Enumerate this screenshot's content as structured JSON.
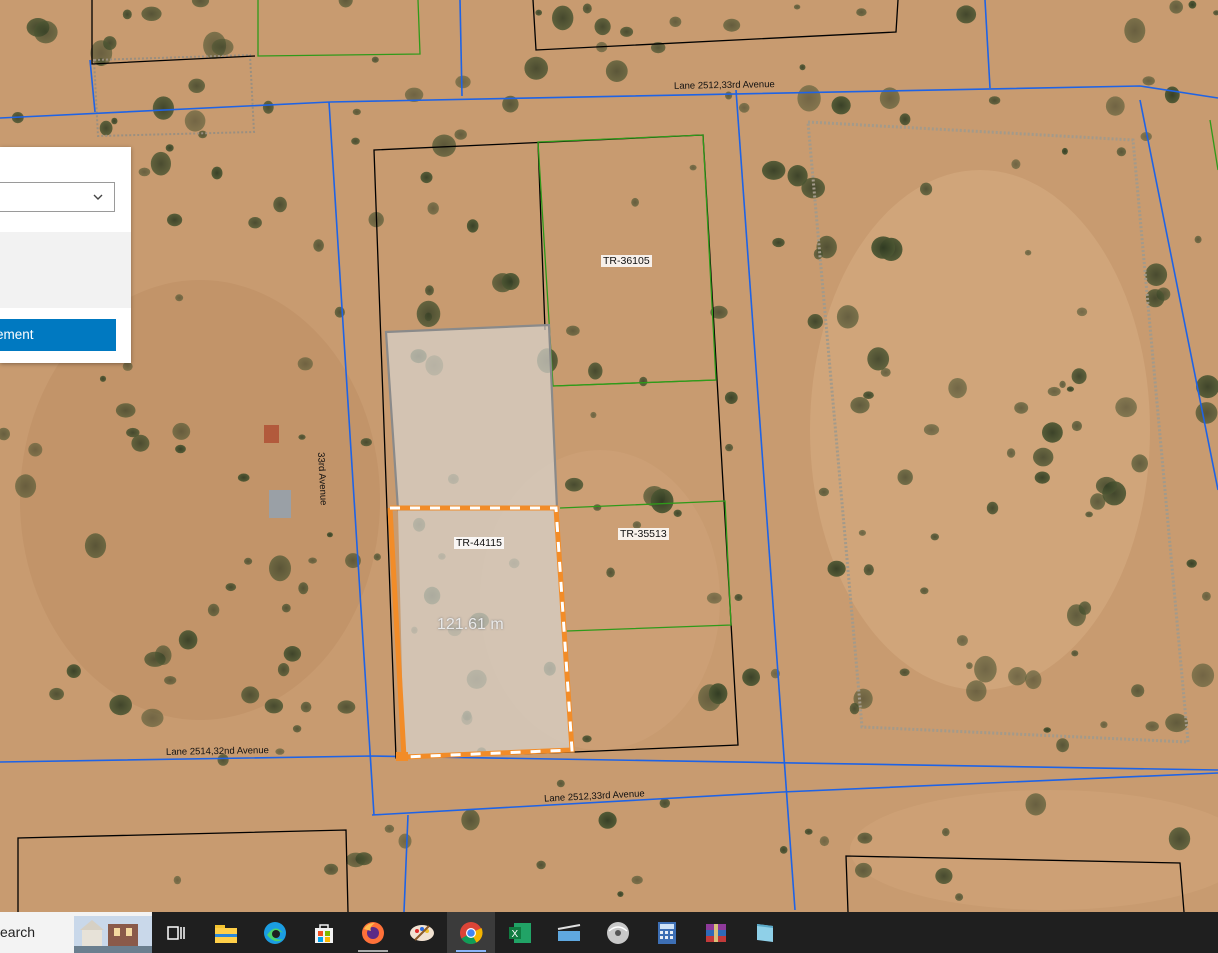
{
  "map": {
    "road_labels": [
      "Lane 2512,33rd Avenue",
      "33rd Avenue",
      "Lane 2514,32nd Avenue",
      "Lane 2512,33rd Avenue"
    ],
    "parcel_labels": [
      "TR-36105",
      "TR-44115",
      "TR-35513"
    ],
    "measurement": "121.61 m",
    "colors": {
      "parcel_border": "#000000",
      "road_line": "#1e63e6",
      "green_parcel": "#2f9a1a",
      "selection": "#f28c28",
      "ground": "#c79a70"
    }
  },
  "panel": {
    "dropdown_value": "",
    "button_label": "ement"
  },
  "taskbar": {
    "search_text": "earch",
    "icons": [
      "task-view-icon",
      "file-explorer-icon",
      "edge-icon",
      "store-icon",
      "firefox-icon",
      "paint-icon",
      "chrome-icon",
      "excel-icon",
      "notepad-icon",
      "disk-icon",
      "calculator-icon",
      "archive-icon",
      "tablet-icon"
    ]
  }
}
